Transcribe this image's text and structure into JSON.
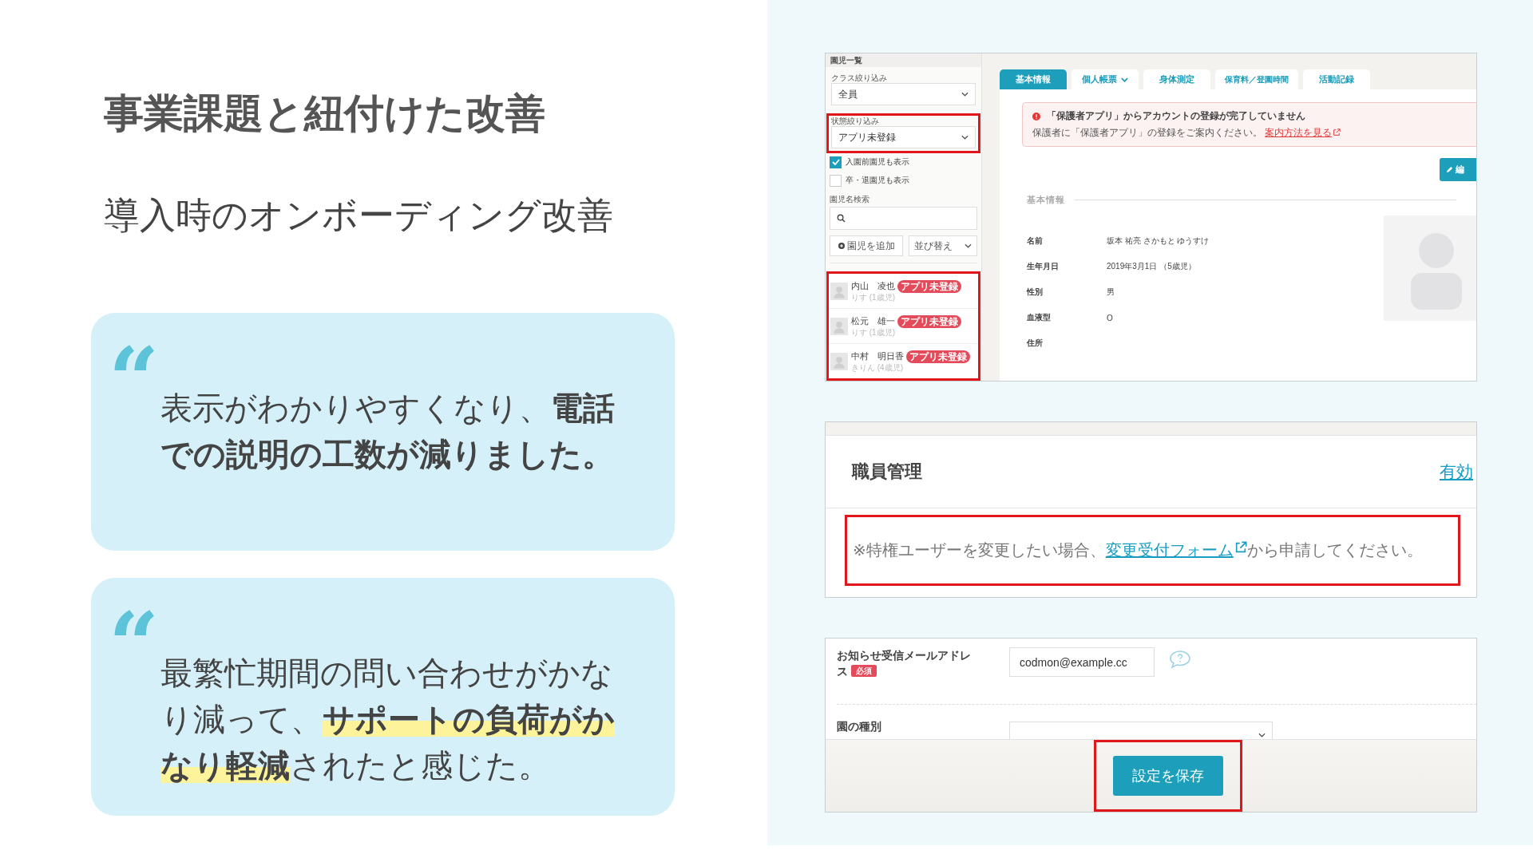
{
  "slide": {
    "title": "事業課題と紐付けた改善",
    "subtitle": "導入時のオンボーディング改善"
  },
  "testimonials": [
    {
      "quote_mark": "“",
      "text": "表示がわかりやすくなり、**電話での説明の工数が減りました。**",
      "marker": false
    },
    {
      "quote_mark": "“",
      "text": "最繁忙期間の問い合わせがかなり減って、**サポートの負荷がかなり軽減**されたと感じた。",
      "marker": true
    }
  ],
  "child_profile": {
    "sidebar": {
      "header": "園児一覧",
      "class_filter": {
        "label": "クラス絞り込み",
        "value": "全員",
        "highlighted": false
      },
      "status_filter": {
        "label": "状態絞り込み",
        "value": "アプリ未登録",
        "highlighted": true
      },
      "options": [
        {
          "label": "入園前園児も表示",
          "checked": true
        },
        {
          "label": "卒・退園児も表示",
          "checked": false
        }
      ],
      "search_label": "園児名検索",
      "add_button": "園児を追加",
      "sort_select": "並び替え",
      "children_highlighted": true,
      "children": [
        {
          "name": "内山　凌也",
          "class": "りす (1歳児)",
          "badge": "アプリ未登録"
        },
        {
          "name": "松元　雄一",
          "class": "りす (1歳児)",
          "badge": "アプリ未登録"
        },
        {
          "name": "中村　明日香",
          "class": "きりん (4歳児)",
          "badge": "アプリ未登録"
        }
      ]
    },
    "tabs": [
      {
        "label": "基本情報",
        "selected": true,
        "dropdown": false
      },
      {
        "label": "個人帳票",
        "selected": false,
        "dropdown": true
      },
      {
        "label": "身体測定",
        "selected": false,
        "dropdown": false
      },
      {
        "label": "保育料／登園時間",
        "selected": false,
        "dropdown": false
      },
      {
        "label": "活動記録",
        "selected": false,
        "dropdown": false
      }
    ],
    "alert": {
      "title": "「保護者アプリ」からアカウントの登録が完了していません",
      "message": "保護者に「保護者アプリ」の登録をご案内ください。",
      "link": "案内方法を見る"
    },
    "edit_button": "編",
    "section_title": "基本情報",
    "fields": [
      {
        "label": "名前",
        "value": "坂本 祐亮",
        "reading": "さかもと ゆうすけ"
      },
      {
        "label": "生年月日",
        "value": "2019年3月1日 （5歳児）"
      },
      {
        "label": "性別",
        "value": "男"
      },
      {
        "label": "血液型",
        "value": "O"
      },
      {
        "label": "住所"
      }
    ]
  },
  "staff_management": {
    "title": "職員管理",
    "header_link": "有効",
    "notice": {
      "before": "※特権ユーザーを変更したい場合、",
      "link": "変更受付フォーム",
      "after": "から申請してください。",
      "highlighted": true
    }
  },
  "settings_form": {
    "email": {
      "label": "お知らせ受信メールアドレス",
      "required_badge": "必須",
      "value": "codmon@example.cc"
    },
    "kind_label": "園の種別",
    "save_button": "設定を保存",
    "save_highlighted": true
  }
}
